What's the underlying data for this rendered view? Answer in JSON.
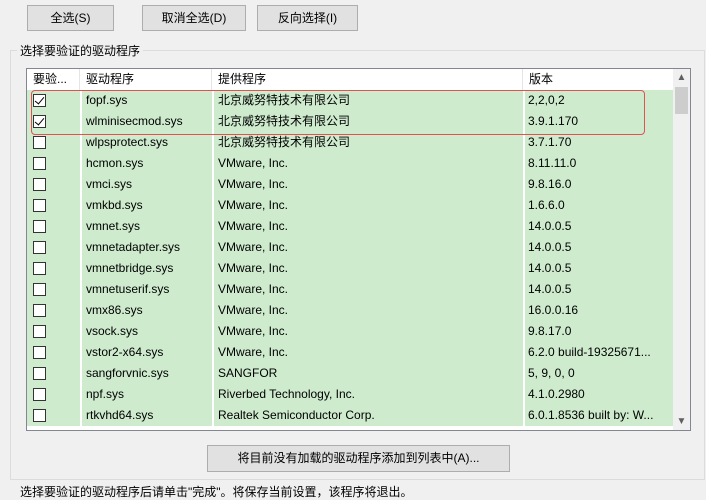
{
  "toolbar": {
    "select_all": "全选(S)",
    "deselect_all": "取消全选(D)",
    "invert": "反向选择(I)"
  },
  "group_label": "选择要验证的驱动程序",
  "table": {
    "columns": [
      "要验...",
      "驱动程序",
      "提供程序",
      "版本"
    ],
    "rows": [
      {
        "checked": true,
        "driver": "fopf.sys",
        "provider": "北京威努特技术有限公司",
        "version": "2,2,0,2"
      },
      {
        "checked": true,
        "driver": "wlminisecmod.sys",
        "provider": "北京威努特技术有限公司",
        "version": "3.9.1.170"
      },
      {
        "checked": false,
        "driver": "wlpsprotect.sys",
        "provider": "北京威努特技术有限公司",
        "version": "3.7.1.70"
      },
      {
        "checked": false,
        "driver": "hcmon.sys",
        "provider": "VMware, Inc.",
        "version": "8.11.11.0"
      },
      {
        "checked": false,
        "driver": "vmci.sys",
        "provider": "VMware, Inc.",
        "version": "9.8.16.0"
      },
      {
        "checked": false,
        "driver": "vmkbd.sys",
        "provider": "VMware, Inc.",
        "version": "1.6.6.0"
      },
      {
        "checked": false,
        "driver": "vmnet.sys",
        "provider": "VMware, Inc.",
        "version": "14.0.0.5"
      },
      {
        "checked": false,
        "driver": "vmnetadapter.sys",
        "provider": "VMware, Inc.",
        "version": "14.0.0.5"
      },
      {
        "checked": false,
        "driver": "vmnetbridge.sys",
        "provider": "VMware, Inc.",
        "version": "14.0.0.5"
      },
      {
        "checked": false,
        "driver": "vmnetuserif.sys",
        "provider": "VMware, Inc.",
        "version": "14.0.0.5"
      },
      {
        "checked": false,
        "driver": "vmx86.sys",
        "provider": "VMware, Inc.",
        "version": "16.0.0.16"
      },
      {
        "checked": false,
        "driver": "vsock.sys",
        "provider": "VMware, Inc.",
        "version": "9.8.17.0"
      },
      {
        "checked": false,
        "driver": "vstor2-x64.sys",
        "provider": "VMware, Inc.",
        "version": "6.2.0 build-19325671..."
      },
      {
        "checked": false,
        "driver": "sangforvnic.sys",
        "provider": "SANGFOR",
        "version": "5, 9, 0, 0"
      },
      {
        "checked": false,
        "driver": "npf.sys",
        "provider": "Riverbed Technology, Inc.",
        "version": "4.1.0.2980"
      },
      {
        "checked": false,
        "driver": "rtkvhd64.sys",
        "provider": "Realtek Semiconductor Corp.",
        "version": "6.0.1.8536 built by: W..."
      }
    ]
  },
  "scrollbar": {
    "up_icon": "chevron-up-icon",
    "down_icon": "chevron-down-icon"
  },
  "add_button": "将目前没有加载的驱动程序添加到列表中(A)...",
  "footer": "选择要验证的驱动程序后请单击\"完成\"。将保存当前设置，该程序将退出。",
  "colors": {
    "row_bg": "#ceebce",
    "highlight": "#e05252"
  }
}
